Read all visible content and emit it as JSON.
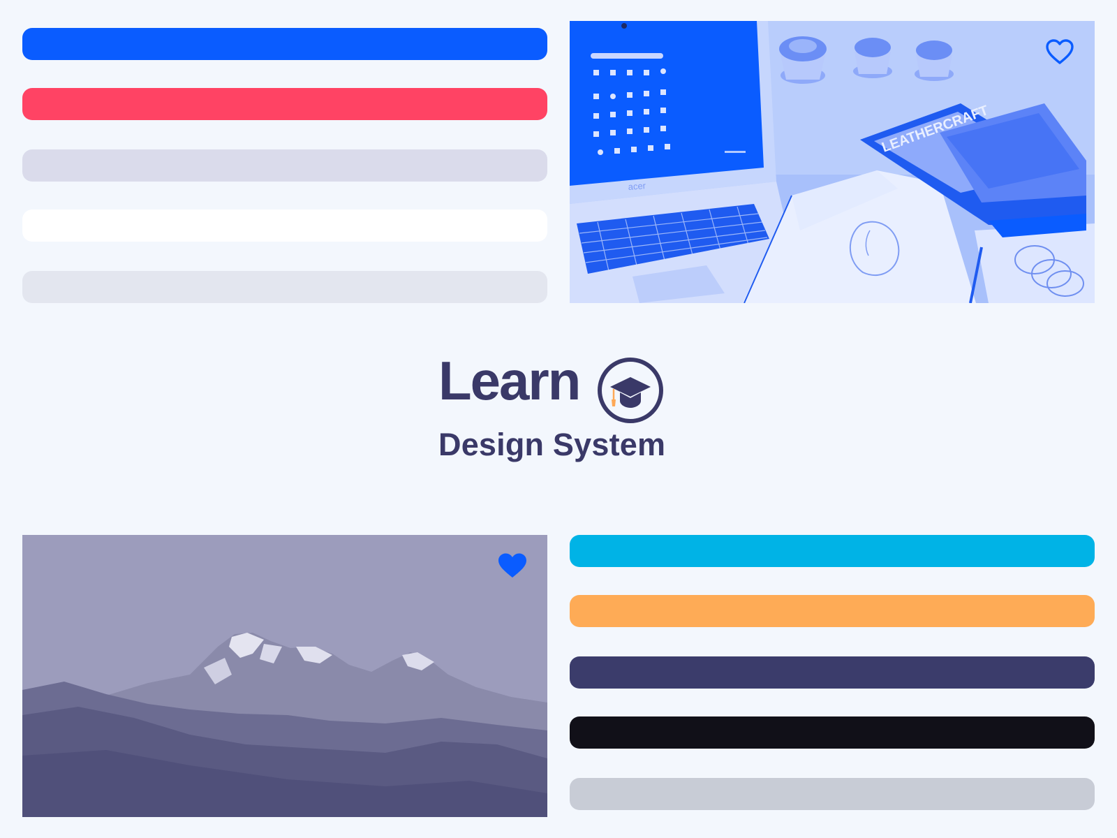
{
  "colors": {
    "background": "#f3f7fd",
    "brand_blue": "#0a5cff",
    "brand_navy": "#3a3968",
    "accent_orange": "#fea957"
  },
  "swatches_top": [
    {
      "color": "#0a5cff"
    },
    {
      "color": "#ff4364"
    },
    {
      "color": "#dadbeb"
    },
    {
      "color": "#ffffff"
    },
    {
      "color": "#e3e6ef"
    }
  ],
  "swatches_bottom": [
    {
      "color": "#00b3e6"
    },
    {
      "color": "#feab56"
    },
    {
      "color": "#3b3c6b"
    },
    {
      "color": "#111018"
    },
    {
      "color": "#c8ccd6"
    }
  ],
  "photo_laptop": {
    "brand_text": "acer",
    "magazine_text": "LEATHERCRAFT",
    "favorite": false,
    "icon": "heart-outline-icon",
    "tint": "#0a5cff"
  },
  "photo_mountain": {
    "favorite": true,
    "icon": "heart-filled-icon",
    "tint": "#52527a"
  },
  "logo": {
    "word": "Learn",
    "subtitle": "Design System",
    "badge_icon": "graduation-cap-icon"
  }
}
